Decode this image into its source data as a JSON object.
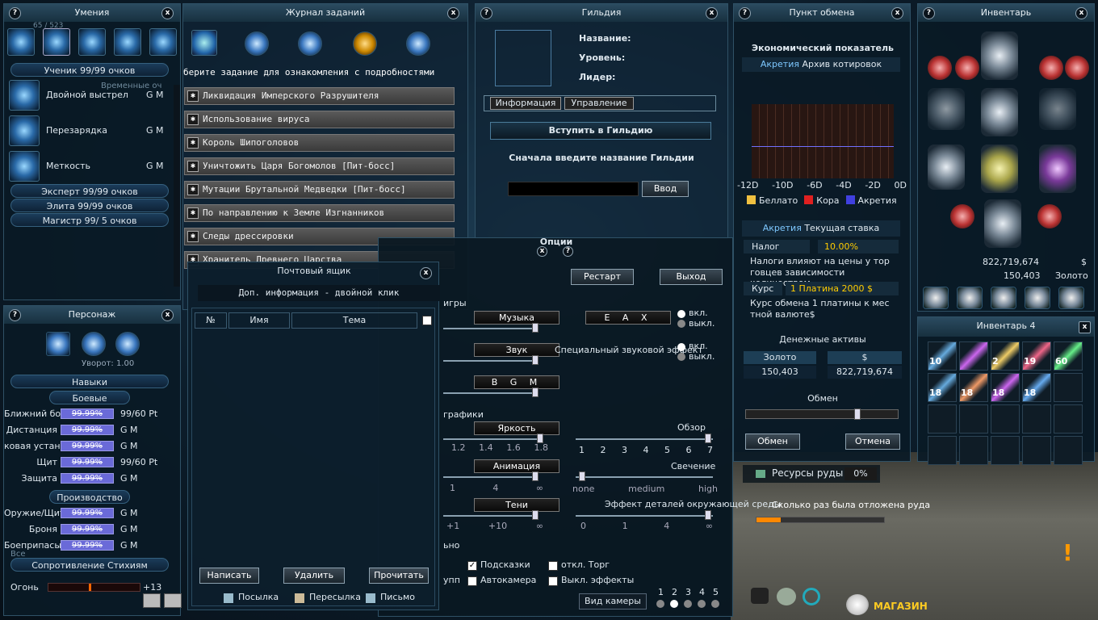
{
  "skills": {
    "title": "Умения",
    "novice": "Ученик 99/99 очков",
    "items": [
      {
        "name": "Двойной выстрел",
        "gm": "G M"
      },
      {
        "name": "Перезарядка",
        "gm": "G M"
      },
      {
        "name": "Меткость",
        "gm": "G M"
      }
    ],
    "expert": "Эксперт 99/99 очков",
    "elite": "Элита 99/99 очков",
    "master": "Магистр 99/ 5 очков",
    "ghost": "Временные оч",
    "ghost2": "65 / 523"
  },
  "quests": {
    "title": "Журнал заданий",
    "hint": "берите задание для ознакомления с подробностями",
    "items": [
      "Ликвидация Имперского Разрушителя",
      "Использование вируса",
      "Король Шипоголовов",
      "Уничтожить Царя Богомолов [Пит-босс]",
      "Мутации Брутальной Медведки [Пит-босс]",
      "По направлению к Земле Изгнанников",
      "Следы дрессировки",
      "Хранитель Древнего Царства"
    ]
  },
  "guild": {
    "title": "Гильдия",
    "name_label": "Название:",
    "level_label": "Уровень:",
    "leader_label": "Лидер:",
    "tab_info": "Информация",
    "tab_manage": "Управление",
    "join": "Вступить в Гильдию",
    "prompt": "Сначала введите название Гильдии",
    "enter": "Ввод"
  },
  "exchange": {
    "title": "Пункт обмена",
    "indicator": "Экономический показатель",
    "akr1": "Акретия",
    "archive": "Архив котировок",
    "axis": [
      "-12D",
      "-10D",
      "-6D",
      "-4D",
      "-2D",
      "0D"
    ],
    "legend": [
      {
        "name": "Беллато",
        "color": "#f0c040"
      },
      {
        "name": "Кора",
        "color": "#e02020"
      },
      {
        "name": "Акретия",
        "color": "#4040e0"
      }
    ],
    "akr2": "Акретия",
    "rate_title": "Текущая ставка",
    "tax_label": "Налог",
    "tax": "10.00%",
    "tax_note1": "Налоги влияют на цены у тор",
    "tax_note2": "говцев зависимости количеством.",
    "course_label": "Курс",
    "course": "1 Платина 2000 $",
    "course_note1": "Курс обмена 1 платины к мес",
    "course_note2": "тной валюте$",
    "assets": "Денежные активы",
    "gold_label": "Золото",
    "gold": "150,403",
    "dollar_label": "$",
    "dollar": "822,719,674",
    "swap": "Обмен",
    "swap_btn": "Обмен",
    "cancel_btn": "Отмена"
  },
  "inventory": {
    "title": "Инвентарь",
    "money": "822,719,674",
    "money_unit": "$",
    "gold": "150,403",
    "gold_unit": "Золото",
    "inv4": "Инвентарь 4",
    "counts": [
      "10",
      "2",
      "19",
      "60",
      "18",
      "18",
      "18",
      "18"
    ]
  },
  "character": {
    "title": "Персонаж",
    "dodge": "Уворот: 1.00",
    "skills": "Навыки",
    "combat": "Боевые",
    "rows": [
      {
        "name": "Ближний бо",
        "pct": "99.99%",
        "val": "99/60 Pt"
      },
      {
        "name": "Дистанция",
        "pct": "99.99%",
        "val": "G M"
      },
      {
        "name": "ковая устан",
        "pct": "99.99%",
        "val": "G M"
      },
      {
        "name": "Щит",
        "pct": "99.99%",
        "val": "99/60 Pt"
      },
      {
        "name": "Защита",
        "pct": "99.99%",
        "val": "G M"
      }
    ],
    "production": "Производство",
    "prod_rows": [
      {
        "name": "Оружие/Щит",
        "pct": "99.99%",
        "val": "G M"
      },
      {
        "name": "Броня",
        "pct": "99.99%",
        "val": "G M"
      },
      {
        "name": "Боеприпасы",
        "pct": "99.99%",
        "val": "G M"
      }
    ],
    "resist": "Сопротивление Стихиям",
    "fire": "Огонь",
    "fire_val": "+13",
    "ghost": "Все"
  },
  "mail": {
    "title": "Почтовый ящик",
    "info": "Доп. информация - двойной клик",
    "col_no": "№",
    "col_name": "Имя",
    "col_subject": "Тема",
    "write": "Написать",
    "delete": "Удалить",
    "read": "Прочитать",
    "parcel": "Посылка",
    "forward": "Пересылка",
    "letter": "Письмо"
  },
  "options": {
    "title": "Опции",
    "restart": "Рестарт",
    "exit": "Выход",
    "game": "игры",
    "music": "Музыка",
    "sound": "Звук",
    "bgm": "B G M",
    "eax": "E A X",
    "on": "вкл.",
    "off": "выкл.",
    "special": "Специальный звуковой эффект",
    "graphics": "графики",
    "brightness": "Яркость",
    "b_ticks": [
      "1.2",
      "1.4",
      "1.6",
      "1.8"
    ],
    "view": "Обзор",
    "v_ticks": [
      "1",
      "2",
      "3",
      "4",
      "5",
      "6",
      "7"
    ],
    "animation": "Анимация",
    "a_ticks": [
      "1",
      "4",
      "∞"
    ],
    "glow": "Свечение",
    "g_ticks": [
      "none",
      "medium",
      "high"
    ],
    "shadows": "Тени",
    "s_ticks": [
      "+1",
      "+10",
      "∞"
    ],
    "detail": "Эффект деталей окружающей среды",
    "d_ticks": [
      "0",
      "1",
      "4",
      "∞"
    ],
    "hints": "Подсказки",
    "no_trade": "откл. Торг",
    "autocam": "Автокамера",
    "no_effects": "Выкл. эффекты",
    "camera": "Вид камеры",
    "cam_nums": [
      "1",
      "2",
      "3",
      "4",
      "5"
    ],
    "left1": "ьно",
    "left2": "упп"
  },
  "hud": {
    "ore": "Ресурсы руды",
    "ore_pct": "0%",
    "delayed": "Сколько раз была отложена руда",
    "shop": "МАГАЗИН"
  }
}
